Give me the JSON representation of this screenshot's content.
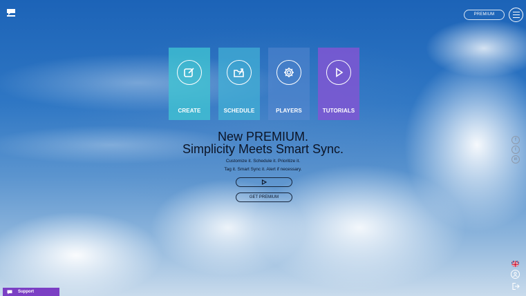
{
  "header": {
    "logo_icon": "chat-bubble-logo-icon",
    "premium_label": "PREMIUM",
    "menu_icon": "hamburger-menu-icon"
  },
  "tiles": [
    {
      "label": "CREATE",
      "icon": "edit-icon",
      "color": "#40c4d2"
    },
    {
      "label": "SCHEDULE",
      "icon": "folder-share-icon",
      "color": "#42b2d6"
    },
    {
      "label": "PLAYERS",
      "icon": "gear-icon",
      "color": "#608cd2"
    },
    {
      "label": "TUTORIALS",
      "icon": "play-icon",
      "color": "#8056d2"
    }
  ],
  "hero": {
    "headline_1": "New PREMIUM.",
    "headline_2": "Simplicity Meets Smart Sync.",
    "sub_1": "Customize it. Schedule it. Prioritize it.",
    "sub_2": "Tag it. Smart Sync it. Alert if necessary.",
    "play_icon": "play-icon",
    "get_premium_label": "GET PREMIUM"
  },
  "social": [
    {
      "label": "f",
      "icon": "facebook-icon"
    },
    {
      "label": "t",
      "icon": "twitter-icon"
    },
    {
      "label": "in",
      "icon": "linkedin-icon"
    }
  ],
  "footer": {
    "language_icon": "uk-flag-icon",
    "account_icon": "account-icon",
    "logout_icon": "logout-icon",
    "support_label": "Support",
    "support_icon": "chat-icon",
    "support_color": "#7b3fc4"
  }
}
